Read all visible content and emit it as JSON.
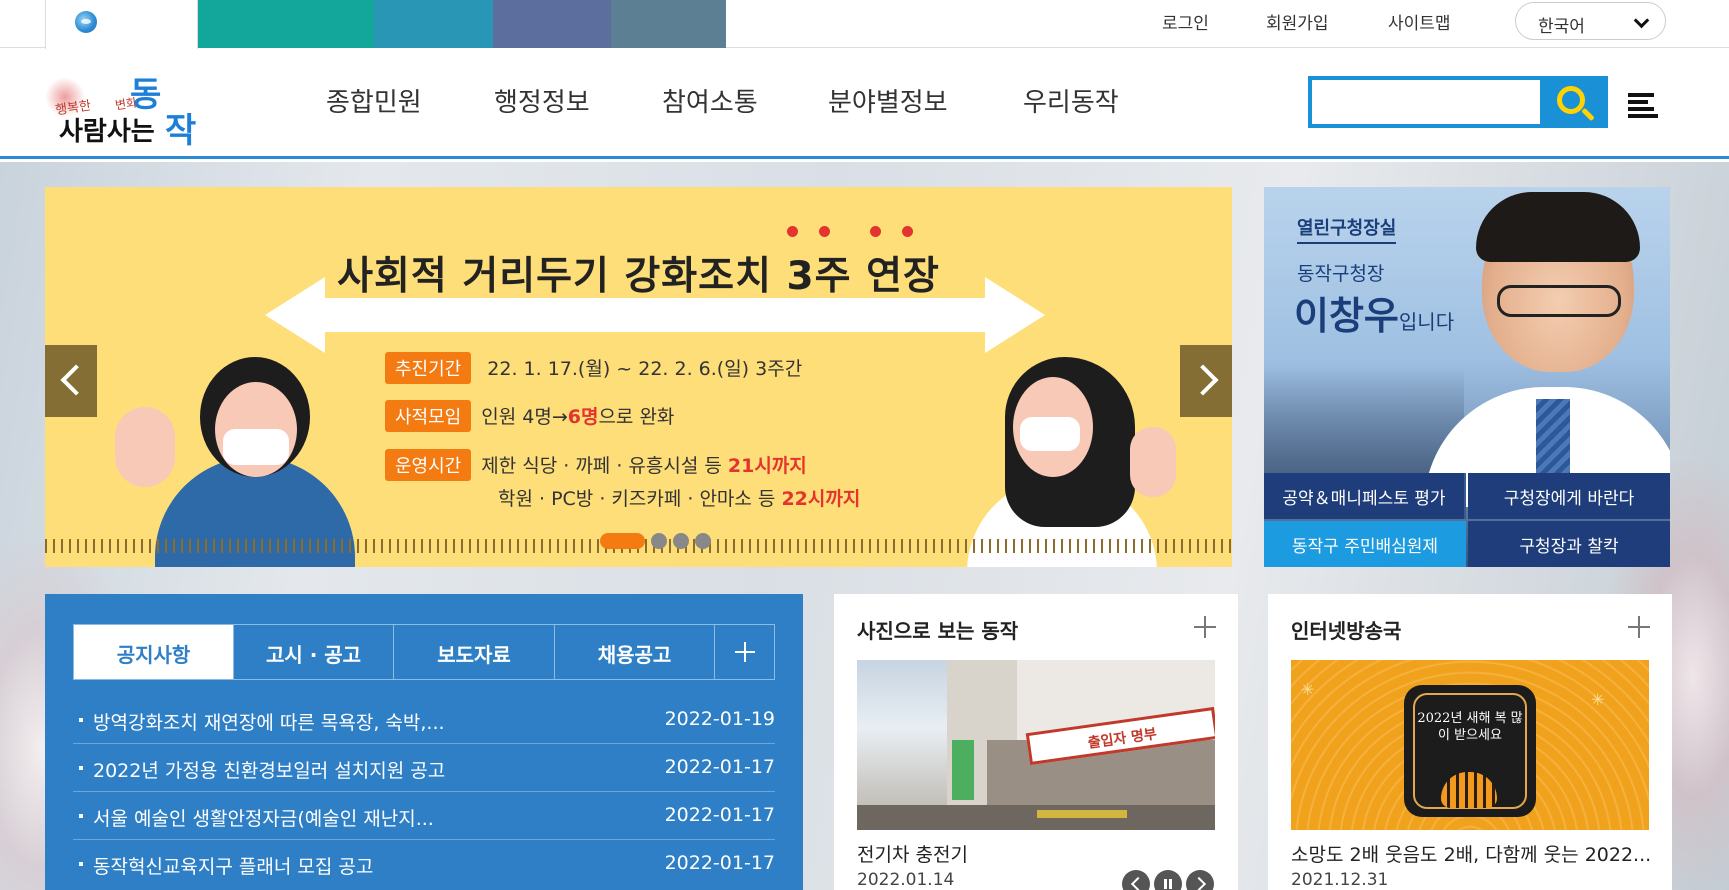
{
  "top_bar": {
    "color_tabs": [
      "#13a79c",
      "#2896b4",
      "#5c7f94",
      "#5c6e9e",
      "#8870a0",
      "#8a5e6e"
    ],
    "links": [
      "로그인",
      "회원가입",
      "사이트맵"
    ],
    "language": "한국어"
  },
  "header": {
    "logo": {
      "slogan_small1": "행복한",
      "slogan_small2": "변화",
      "word_dong": "동",
      "word_main": "사람사는",
      "word_jak": "작"
    },
    "nav": [
      "종합민원",
      "행정정보",
      "참여소통",
      "분야별정보",
      "우리동작"
    ],
    "search_placeholder": ""
  },
  "banner": {
    "title": "사회적 거리두기 강화조치 3주 연장",
    "rows": [
      {
        "label": "추진기간",
        "text": "22. 1. 17.(월) ~ 22. 2. 6.(일) 3주간"
      },
      {
        "label": "사적모임",
        "pre": "인원 4명→",
        "hl": "6명",
        "post": "으로 완화"
      },
      {
        "label": "운영시간",
        "pre": "제한 식당 · 까페 · 유흥시설 등 ",
        "hl": "21시까지"
      }
    ],
    "line2_pre": "학원 ·  PC방 · 키즈카페 · 안마소 등 ",
    "line2_hl": "22시까지"
  },
  "mayor": {
    "label": "열린구청장실",
    "sub": "동작구청장",
    "name": "이창우",
    "name_suffix": "입니다",
    "buttons": [
      "공약＆매니페스토 평가",
      "구청장에게 바란다",
      "동작구 주민배심원제",
      "구청장과 찰칵"
    ]
  },
  "notice": {
    "tabs": [
      "공지사항",
      "고시 · 공고",
      "보도자료",
      "채용공고"
    ],
    "items": [
      {
        "title": "방역강화조치 재연장에 따른 목욕장, 숙박,...",
        "date": "2022-01-19"
      },
      {
        "title": "2022년 가정용 친환경보일러 설치지원 공고",
        "date": "2022-01-17"
      },
      {
        "title": "서울 예술인 생활안정자금(예술인 재난지...",
        "date": "2022-01-17"
      },
      {
        "title": "동작혁신교육지구 플래너 모집 공고",
        "date": "2022-01-17"
      }
    ]
  },
  "photo_card": {
    "title": "사진으로 보는 동작",
    "sign_text": "출입자 명부",
    "caption": "전기차 충전기",
    "date": "2022.01.14"
  },
  "broadcast_card": {
    "title": "인터넷방송국",
    "image_text": "2022년 새해 복 많이 받으세요",
    "caption": "소망도 2배 웃음도 2배, 다함께 웃는 2022...",
    "date": "2021.12.31"
  },
  "colors": {
    "accent": "#1a90d6",
    "notice_bg": "#2e7fc6",
    "mayor_btn_dark": "#1f3d7a",
    "mayor_btn_light": "#1c9be0",
    "banner_bg": "#fede78",
    "banner_label": "#f47b12"
  }
}
